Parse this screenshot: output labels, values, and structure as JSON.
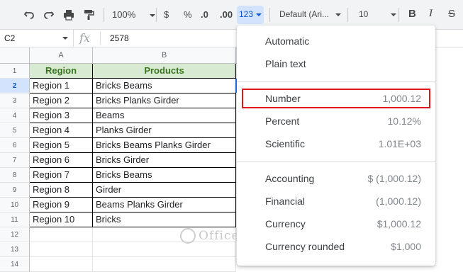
{
  "toolbar": {
    "zoom": "100%",
    "currency_symbol": "$",
    "percent_symbol": "%",
    "decrease_decimal": ".0",
    "increase_decimal": ".00",
    "more_formats": "123",
    "font": "Default (Ari...",
    "font_size": "10",
    "bold": "B",
    "italic": "I",
    "strike": "S"
  },
  "formula_bar": {
    "cell_ref": "C2",
    "fx": "fx",
    "value": "2578"
  },
  "grid": {
    "columns": [
      "A",
      "B"
    ],
    "rows": [
      "1",
      "2",
      "3",
      "4",
      "5",
      "6",
      "7",
      "8",
      "9",
      "10",
      "11",
      "12",
      "13",
      "14"
    ],
    "header": [
      "Region",
      "Products"
    ],
    "data": [
      [
        "Region 1",
        "Bricks Beams"
      ],
      [
        "Region 2",
        "Bricks Planks Girder"
      ],
      [
        "Region 3",
        "Beams"
      ],
      [
        "Region 4",
        "Planks Girder"
      ],
      [
        "Region 5",
        "Bricks Beams Planks Girder"
      ],
      [
        "Region 6",
        "Bricks Girder"
      ],
      [
        "Region 7",
        "Bricks Beams"
      ],
      [
        "Region 8",
        "Girder"
      ],
      [
        "Region 9",
        "Beams Planks Girder"
      ],
      [
        "Region 10",
        "Bricks"
      ]
    ]
  },
  "format_menu": {
    "items": [
      {
        "label": "Automatic",
        "example": ""
      },
      {
        "label": "Plain text",
        "example": ""
      },
      {
        "label": "Number",
        "example": "1,000.12"
      },
      {
        "label": "Percent",
        "example": "10.12%"
      },
      {
        "label": "Scientific",
        "example": "1.01E+03"
      },
      {
        "label": "Accounting",
        "example": "$ (1,000.12)"
      },
      {
        "label": "Financial",
        "example": "(1,000.12)"
      },
      {
        "label": "Currency",
        "example": "$1,000.12"
      },
      {
        "label": "Currency rounded",
        "example": "$1,000"
      }
    ]
  },
  "watermark": "OfficeWheel",
  "colors": {
    "header_fill": "#d9ead3",
    "header_text": "#38761d",
    "highlight": "#e0141c",
    "selection": "#1a73e8"
  }
}
